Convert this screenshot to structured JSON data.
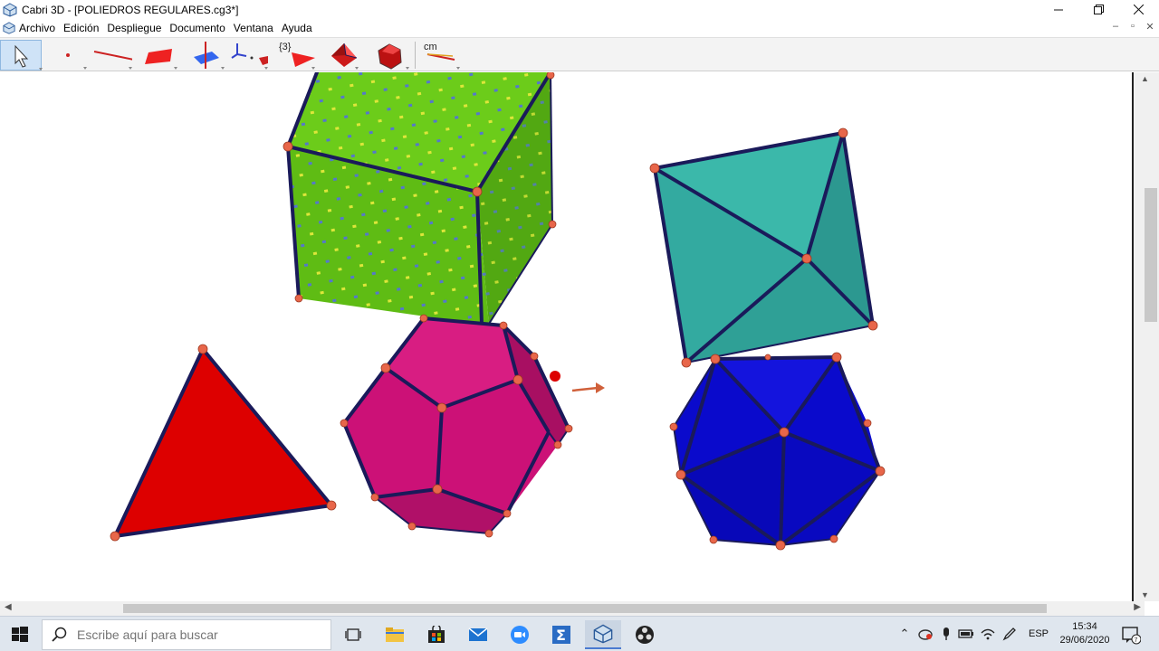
{
  "window": {
    "title": "Cabri 3D - [POLIEDROS REGULARES.cg3*]"
  },
  "menu": {
    "items": [
      {
        "label": "Archivo"
      },
      {
        "label": "Edición"
      },
      {
        "label": "Despliegue"
      },
      {
        "label": "Documento"
      },
      {
        "label": "Ventana"
      },
      {
        "label": "Ayuda"
      }
    ]
  },
  "toolbar": {
    "tools": [
      {
        "name": "pointer-tool"
      },
      {
        "name": "point-tool"
      },
      {
        "name": "line-tool"
      },
      {
        "name": "plane-tool"
      },
      {
        "name": "perpendicular-tool"
      },
      {
        "name": "transform-tool"
      },
      {
        "name": "regular-polygon-tool",
        "label": "{3}"
      },
      {
        "name": "polyhedron-tool"
      },
      {
        "name": "regular-polyhedron-tool"
      },
      {
        "name": "measure-tool",
        "label": "cm"
      }
    ]
  },
  "canvas": {
    "solids": [
      {
        "name": "cube",
        "color": "#6ccc1a"
      },
      {
        "name": "octahedron",
        "color": "#33aaa0"
      },
      {
        "name": "tetrahedron",
        "color": "#dd0000"
      },
      {
        "name": "dodecahedron",
        "color": "#cc1177"
      },
      {
        "name": "icosahedron",
        "color": "#0a0acc"
      }
    ],
    "vertex_color": "#e8664a",
    "edge_color": "#1a1a5a"
  },
  "taskbar": {
    "search_placeholder": "Escribe aquí para buscar",
    "language": "ESP",
    "time": "15:34",
    "date": "29/06/2020"
  }
}
